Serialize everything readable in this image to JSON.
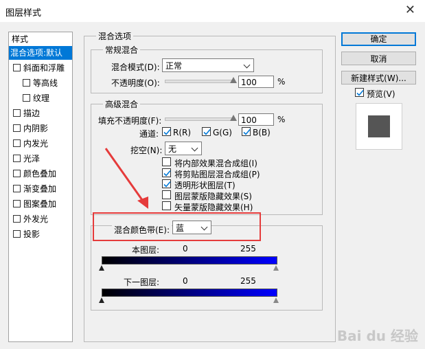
{
  "window": {
    "title": "图层样式"
  },
  "style_list": {
    "header": "样式",
    "items": [
      {
        "label": "混合选项:默认",
        "checkbox": false,
        "selected": true,
        "indent": 0
      },
      {
        "label": "斜面和浮雕",
        "checkbox": true,
        "selected": false,
        "indent": 0
      },
      {
        "label": "等高线",
        "checkbox": true,
        "selected": false,
        "indent": 1
      },
      {
        "label": "纹理",
        "checkbox": true,
        "selected": false,
        "indent": 1
      },
      {
        "label": "描边",
        "checkbox": true,
        "selected": false,
        "indent": 0
      },
      {
        "label": "内阴影",
        "checkbox": true,
        "selected": false,
        "indent": 0
      },
      {
        "label": "内发光",
        "checkbox": true,
        "selected": false,
        "indent": 0
      },
      {
        "label": "光泽",
        "checkbox": true,
        "selected": false,
        "indent": 0
      },
      {
        "label": "颜色叠加",
        "checkbox": true,
        "selected": false,
        "indent": 0
      },
      {
        "label": "渐变叠加",
        "checkbox": true,
        "selected": false,
        "indent": 0
      },
      {
        "label": "图案叠加",
        "checkbox": true,
        "selected": false,
        "indent": 0
      },
      {
        "label": "外发光",
        "checkbox": true,
        "selected": false,
        "indent": 0
      },
      {
        "label": "投影",
        "checkbox": true,
        "selected": false,
        "indent": 0
      }
    ]
  },
  "blend_options": {
    "title": "混合选项",
    "general": {
      "title": "常规混合",
      "mode_label": "混合模式(D):",
      "mode_value": "正常",
      "opacity_label": "不透明度(O):",
      "opacity_value": "100",
      "opacity_unit": "%",
      "opacity_fraction": 1.0
    },
    "advanced": {
      "title": "高级混合",
      "fill_label": "填充不透明度(F):",
      "fill_value": "100",
      "fill_unit": "%",
      "fill_fraction": 1.0,
      "channels_label": "通道:",
      "channel_r": "R(R)",
      "channel_g": "G(G)",
      "channel_b": "B(B)",
      "knockout_label": "挖空(N):",
      "knockout_value": "无",
      "options": [
        {
          "label": "将内部效果混合成组(I)",
          "checked": false
        },
        {
          "label": "将剪贴图层混合成组(P)",
          "checked": true
        },
        {
          "label": "透明形状图层(T)",
          "checked": true
        },
        {
          "label": "图层蒙版隐藏效果(S)",
          "checked": false
        },
        {
          "label": "矢量蒙版隐藏效果(H)",
          "checked": false
        }
      ]
    },
    "blend_if": {
      "label": "混合颜色带(E):",
      "value": "蓝",
      "this_layer_label": "本图层:",
      "this_layer_min": "0",
      "this_layer_max": "255",
      "underlying_label": "下一图层:",
      "underlying_min": "0",
      "underlying_max": "255",
      "gradient_start": "#000000",
      "gradient_end": "#0000ff"
    }
  },
  "buttons": {
    "ok": "确定",
    "cancel": "取消",
    "new_style": "新建样式(W)...",
    "preview_label": "预览(V)",
    "preview_checked": true
  },
  "watermark": "Bai du 经验",
  "colors": {
    "accent": "#0078d7",
    "annotation": "#e53b3b",
    "preview_swatch": "#555555"
  }
}
